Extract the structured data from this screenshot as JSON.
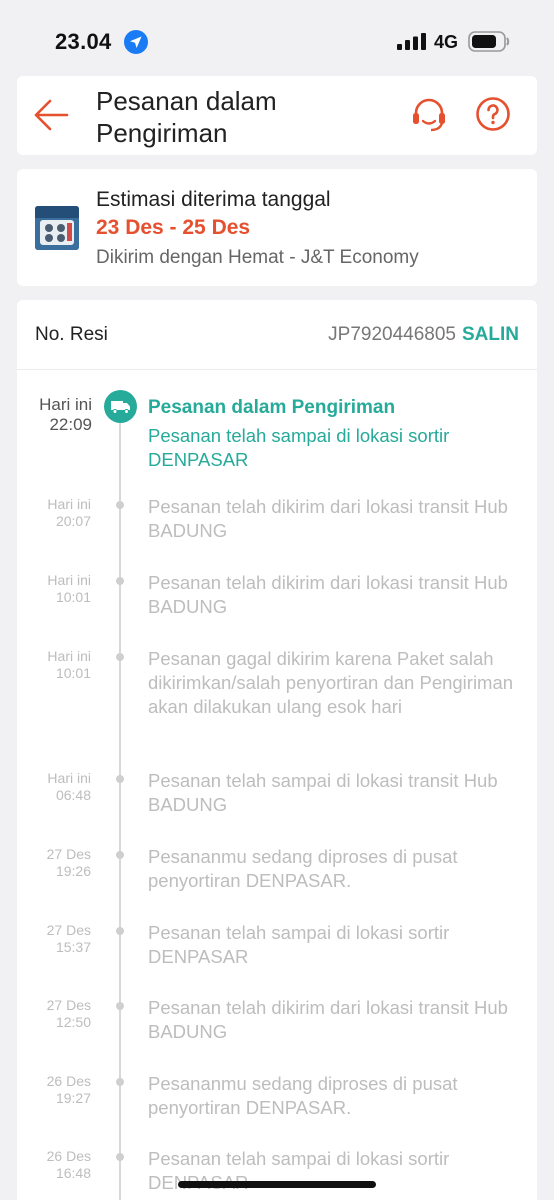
{
  "status_bar": {
    "time": "23.04",
    "network": "4G"
  },
  "header": {
    "title": "Pesanan dalam Pengiriman"
  },
  "estimate": {
    "label": "Estimasi diterima tanggal",
    "date_range": "23 Des - 25 Des",
    "courier": "Dikirim dengan Hemat - J&T Economy"
  },
  "tracking": {
    "resi_label": "No. Resi",
    "resi_number": "JP7920446805",
    "copy_label": "SALIN",
    "current": {
      "time_line1": "Hari ini",
      "time_line2": "22:09",
      "status": "Pesanan dalam Pengiriman",
      "description": "Pesanan telah sampai di lokasi sortir DENPASAR"
    },
    "events": [
      {
        "time_line1": "Hari ini",
        "time_line2": "20:07",
        "description": "Pesanan telah dikirim dari lokasi transit Hub BADUNG"
      },
      {
        "time_line1": "Hari ini",
        "time_line2": "10:01",
        "description": "Pesanan telah dikirim dari lokasi transit Hub BADUNG"
      },
      {
        "time_line1": "Hari ini",
        "time_line2": "10:01",
        "description": "Pesanan gagal dikirim karena Paket salah dikirimkan/salah penyortiran dan Pengiriman akan dilakukan ulang esok hari"
      },
      {
        "time_line1": "Hari ini",
        "time_line2": "06:48",
        "description": "Pesanan telah sampai di lokasi transit Hub BADUNG"
      },
      {
        "time_line1": "27 Des",
        "time_line2": "19:26",
        "description": "Pesananmu sedang diproses di pusat penyortiran DENPASAR."
      },
      {
        "time_line1": "27 Des",
        "time_line2": "15:37",
        "description": "Pesanan telah sampai di lokasi sortir DENPASAR"
      },
      {
        "time_line1": "27 Des",
        "time_line2": "12:50",
        "description": "Pesanan telah dikirim dari lokasi transit Hub BADUNG"
      },
      {
        "time_line1": "26 Des",
        "time_line2": "19:27",
        "description": "Pesananmu sedang diproses di pusat penyortiran DENPASAR."
      },
      {
        "time_line1": "26 Des",
        "time_line2": "16:48",
        "description": "Pesanan telah sampai di lokasi sortir DENPASAR"
      }
    ]
  },
  "colors": {
    "accent": "#e5502f",
    "success": "#26aa99",
    "muted": "#bdbdbd"
  }
}
